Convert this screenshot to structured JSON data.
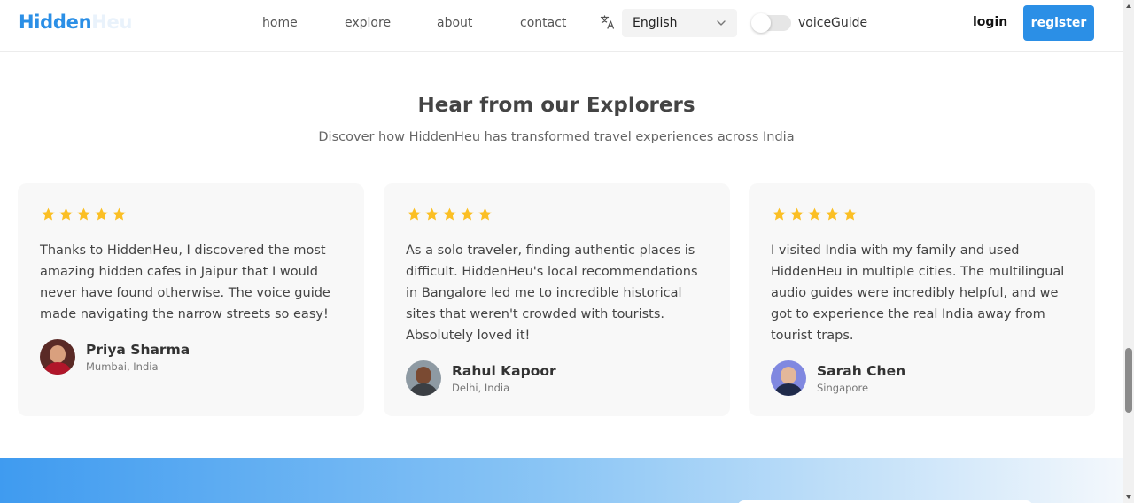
{
  "header": {
    "logo_primary": "Hidden",
    "logo_secondary": "Heu",
    "nav": [
      "home",
      "explore",
      "about",
      "contact"
    ],
    "language": "English",
    "voice_guide_label": "voiceGuide",
    "voice_guide_on": false,
    "login_label": "login",
    "register_label": "register"
  },
  "section": {
    "title": "Hear from our Explorers",
    "subtitle": "Discover how HiddenHeu has transformed travel experiences across India"
  },
  "testimonials": [
    {
      "rating": 5,
      "quote": "Thanks to HiddenHeu, I discovered the most amazing hidden cafes in Jaipur that I would never have found otherwise. The voice guide made navigating the narrow streets so easy!",
      "name": "Priya Sharma",
      "location": "Mumbai, India"
    },
    {
      "rating": 5,
      "quote": "As a solo traveler, finding authentic places is difficult. HiddenHeu's local recommendations in Bangalore led me to incredible historical sites that weren't crowded with tourists. Absolutely loved it!",
      "name": "Rahul Kapoor",
      "location": "Delhi, India"
    },
    {
      "rating": 5,
      "quote": "I visited India with my family and used HiddenHeu in multiple cities. The multilingual audio guides were incredibly helpful, and we got to experience the real India away from tourist traps.",
      "name": "Sarah Chen",
      "location": "Singapore"
    }
  ],
  "colors": {
    "brand": "#2b8fe6",
    "star": "#fbbf24",
    "card_bg": "#f8f8f8"
  },
  "icons": {
    "translate": "translate-icon",
    "dropdown": "chevron-down-icon",
    "rating": "star-icon"
  }
}
